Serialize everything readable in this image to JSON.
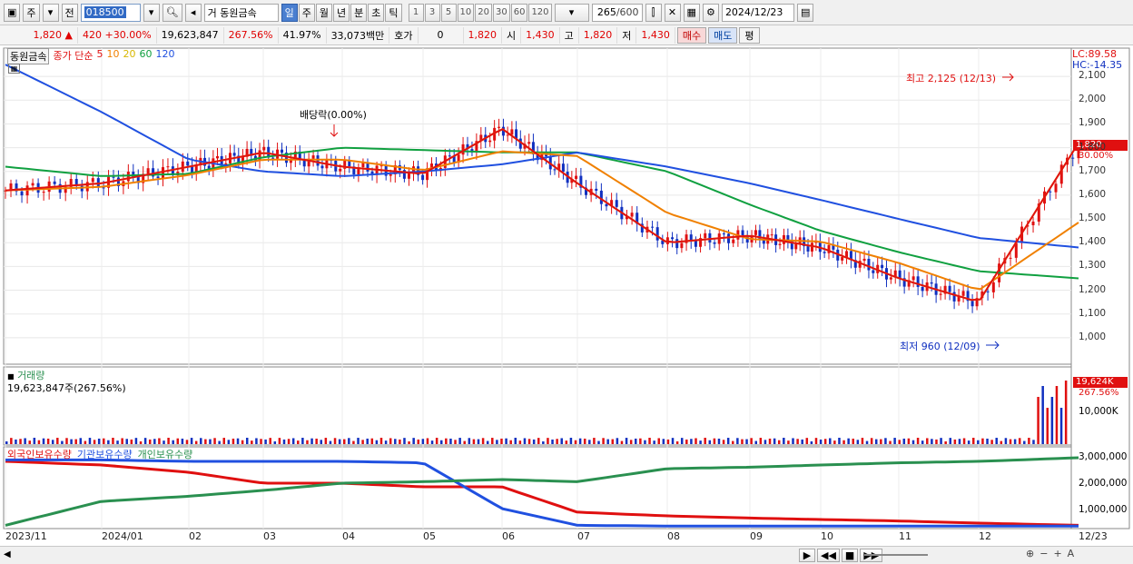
{
  "toolbar": {
    "mode_label": "주",
    "prev_label": "전",
    "code_value": "018500",
    "exchange_label": "거",
    "stock_name": "동원금속",
    "period_tabs": [
      "일",
      "주",
      "월",
      "년",
      "분",
      "초",
      "틱"
    ],
    "active_period": "일",
    "interval_buttons": [
      "1",
      "3",
      "5",
      "10",
      "20",
      "30",
      "60",
      "120"
    ],
    "count_value": "265",
    "count_total": "/600",
    "date_value": "2024/12/23"
  },
  "quote": {
    "price": "1,820",
    "change": "420",
    "change_pct": "+30.00%",
    "volume": "19,623,847",
    "volume_pct": "267.56%",
    "turnover_pct": "41.97%",
    "amount": "33,073백만",
    "hoga_label": "호가",
    "hoga_value": "0",
    "hoga_price": "1,820",
    "open_label": "시",
    "open_value": "1,430",
    "high_label": "고",
    "high_value": "1,820",
    "low_label": "저",
    "low_value": "1,430",
    "buy_label": "매수",
    "sell_label": "매도",
    "eval_label": "평"
  },
  "price_panel": {
    "name_tag": "동원금속",
    "ma_label": "종가 단순",
    "ma_periods": [
      "5",
      "10",
      "20",
      "60",
      "120"
    ],
    "ma_colors": [
      "#e01010",
      "#f08000",
      "#f0d000",
      "#10a040",
      "#2050e0"
    ],
    "lc_label": "LC:89.58",
    "hc_label": "HC:-14.35",
    "dividend_note": "배당락(0.00%)",
    "high_note": "최고 2,125 (12/13)",
    "low_note": "최저 960 (12/09)",
    "current_price_tag": "1,820",
    "current_pct_tag": "30.00%",
    "y_ticks": [
      "2,100",
      "2,000",
      "1,900",
      "1,800",
      "1,700",
      "1,600",
      "1,500",
      "1,400",
      "1,300",
      "1,200",
      "1,100",
      "1,000"
    ]
  },
  "volume_panel": {
    "title": "거래량",
    "value_text": "19,623,847주(267.56%)",
    "tag_value": "19,624K",
    "tag_pct": "267.56%",
    "y_tick": "10,000K"
  },
  "holding_panel": {
    "legend": [
      "외국인보유수량",
      "기관보유수량",
      "개인보유수량"
    ],
    "colors": [
      "#e01010",
      "#2050e0",
      "#2a9050"
    ],
    "y_ticks": [
      "3,000,000",
      "2,000,000",
      "1,000,000"
    ]
  },
  "x_axis": [
    "2023/11",
    "2024/01",
    "02",
    "03",
    "04",
    "05",
    "06",
    "07",
    "08",
    "09",
    "10",
    "11",
    "12",
    "12/23"
  ],
  "chart_data": {
    "type": "line",
    "title": "",
    "x": [
      "2023/11",
      "2024/01",
      "02",
      "03",
      "04",
      "05",
      "06",
      "07",
      "08",
      "09",
      "10",
      "11",
      "12",
      "12/23"
    ],
    "series": [
      {
        "name": "종가",
        "values": [
          1620,
          1650,
          1720,
          1780,
          1720,
          1690,
          1880,
          1650,
          1400,
          1430,
          1380,
          1250,
          1150,
          1820
        ]
      },
      {
        "name": "120",
        "values": [
          2150,
          1950,
          1750,
          1700,
          1680,
          1700,
          1730,
          1780,
          1720,
          1650,
          1580,
          1500,
          1420,
          1380
        ]
      },
      {
        "name": "60",
        "values": [
          1720,
          1680,
          1690,
          1760,
          1800,
          1790,
          1780,
          1780,
          1700,
          1560,
          1450,
          1360,
          1280,
          1250
        ]
      }
    ],
    "ylim": [
      900,
      2200
    ],
    "high_point": {
      "date": "12/13",
      "value": 2125
    },
    "low_point": {
      "date": "12/09",
      "value": 960
    }
  }
}
